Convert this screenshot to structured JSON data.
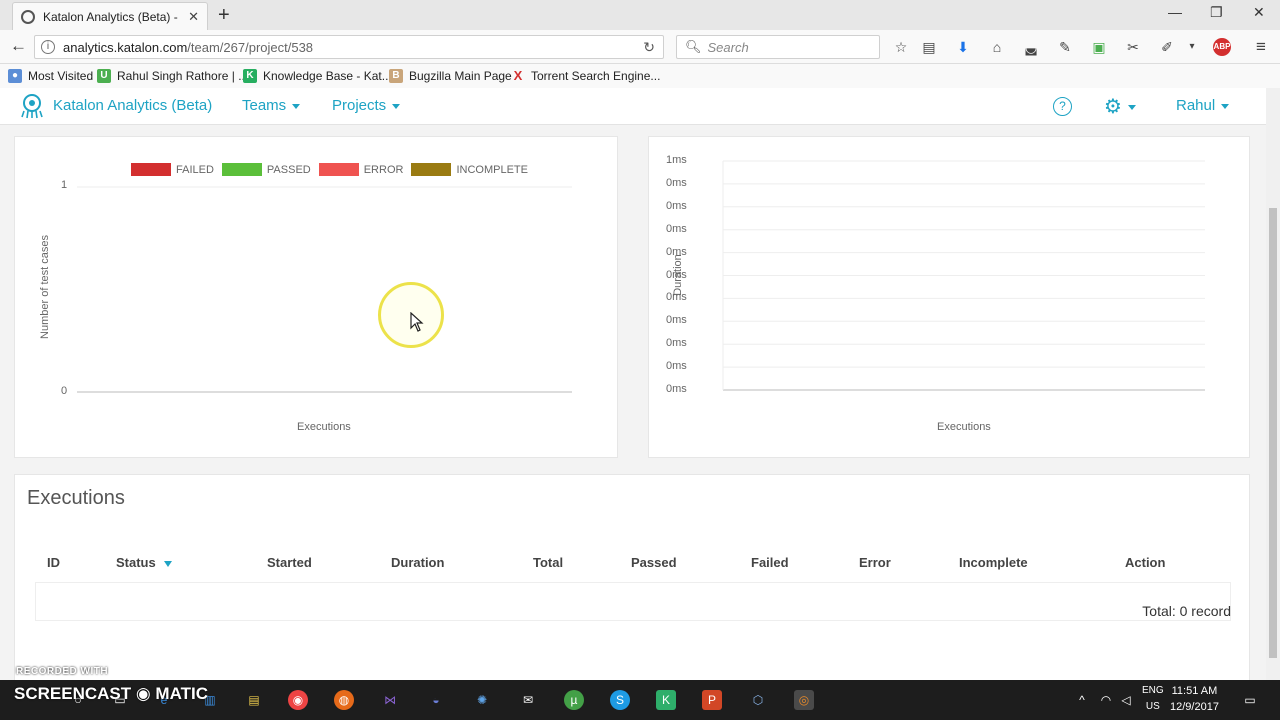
{
  "browser": {
    "tab_title": "Katalon Analytics (Beta) - Pr",
    "url_domain": "analytics.katalon.com",
    "url_path": "/team/267/project/538",
    "search_placeholder": "Search",
    "bookmarks": [
      {
        "label": "Most Visited"
      },
      {
        "label": "Rahul Singh Rathore | ..."
      },
      {
        "label": "Knowledge Base - Kat..."
      },
      {
        "label": "Bugzilla Main Page"
      },
      {
        "label": "Torrent Search Engine..."
      }
    ]
  },
  "app": {
    "brand": "Katalon Analytics (Beta)",
    "nav": {
      "teams": "Teams",
      "projects": "Projects"
    },
    "help": "?",
    "user": "Rahul",
    "accent": "#1ea3c4"
  },
  "status_chart": {
    "chart_data": {
      "type": "bar",
      "categories": [],
      "series": [
        {
          "name": "FAILED",
          "color": "#d32f2f",
          "values": []
        },
        {
          "name": "PASSED",
          "color": "#5bbf3a",
          "values": []
        },
        {
          "name": "ERROR",
          "color": "#ef5350",
          "values": []
        },
        {
          "name": "INCOMPLETE",
          "color": "#9a7b12",
          "values": []
        }
      ],
      "ylabel": "Number of test cases",
      "xlabel": "Executions",
      "yticks": [
        "1",
        "0"
      ],
      "ylim": [
        0,
        1
      ],
      "legend": "top"
    }
  },
  "duration_chart": {
    "chart_data": {
      "type": "line",
      "categories": [],
      "series": [],
      "ylabel": "Duration",
      "xlabel": "Executions",
      "yticks": [
        "1ms",
        "0ms",
        "0ms",
        "0ms",
        "0ms",
        "0ms",
        "0ms",
        "0ms",
        "0ms",
        "0ms",
        "0ms"
      ],
      "grid": true
    }
  },
  "executions": {
    "title": "Executions",
    "columns": [
      "ID",
      "Status",
      "Started",
      "Duration",
      "Total",
      "Passed",
      "Failed",
      "Error",
      "Incomplete",
      "Action"
    ],
    "rows": [],
    "total": "Total: 0 record"
  },
  "taskbar": {
    "watermark_top": "RECORDED WITH",
    "watermark_brand": "SCREENCAST ◉ MATIC",
    "lang_top": "ENG",
    "lang_bottom": "US",
    "time": "11:51 AM",
    "date": "12/9/2017"
  }
}
